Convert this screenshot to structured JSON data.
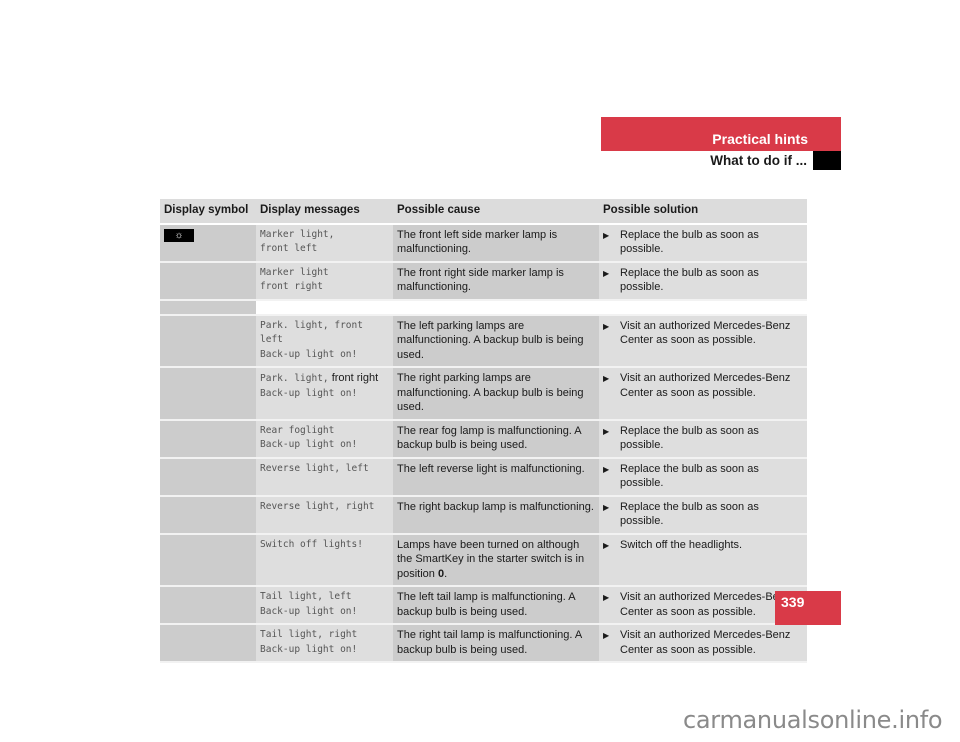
{
  "header": {
    "section_title": "Practical hints",
    "subsection_title": "What to do if ..."
  },
  "table": {
    "columns": [
      "Display symbol",
      "Display messages",
      "Possible cause",
      "Possible solution"
    ],
    "symbol": {
      "icon": "lamp-icon",
      "glyph": "☼"
    },
    "rows": [
      {
        "msg1": "Marker light,",
        "msg2": "front left",
        "cause": "The front left side marker lamp is malfunctioning.",
        "solution": "Replace the bulb as soon as possible."
      },
      {
        "msg1": "Marker light",
        "msg2": "front right",
        "cause": "The front right side marker lamp is malfunctioning.",
        "solution": "Replace the bulb as soon as possible."
      },
      {
        "msg1": "Park. light, front left",
        "msg2": "Back-up light on!",
        "cause": "The left parking lamps are malfunctioning. A backup bulb is being used.",
        "solution": "Visit an authorized Mercedes-Benz Center as soon as possible."
      },
      {
        "msg1": "Park. light,",
        "msg1_plain": " front right",
        "msg2": "Back-up light on!",
        "cause": "The right parking lamps are malfunctioning. A backup bulb is being used.",
        "solution": "Visit an authorized Mercedes-Benz Center as soon as possible."
      },
      {
        "msg1": "Rear foglight",
        "msg2": "Back-up light on!",
        "cause": "The rear fog lamp is malfunctioning. A backup bulb is being used.",
        "solution": "Replace the bulb as soon as possible."
      },
      {
        "msg1": "Reverse light, left",
        "msg2": "",
        "cause": "The left reverse light is malfunctioning.",
        "solution": "Replace the bulb as soon as possible."
      },
      {
        "msg1": "Reverse light, right",
        "msg2": "",
        "cause": "The right backup lamp is malfunctioning.",
        "solution": "Replace the bulb as soon as possible."
      },
      {
        "msg1": "Switch off lights!",
        "msg2": "",
        "cause": "Lamps have been turned on although the SmartKey in the starter switch is in position ",
        "cause_bold": "0",
        "cause_end": ".",
        "solution": "Switch off the headlights."
      },
      {
        "msg1": "Tail light, left",
        "msg2": "Back-up light on!",
        "cause": "The left tail lamp is malfunctioning. A backup bulb is being used.",
        "solution": "Visit an authorized Mercedes-Benz Center as soon as possible."
      },
      {
        "msg1": "Tail light, right",
        "msg2": "Back-up light on!",
        "cause": "The right tail lamp is malfunctioning. A backup bulb is being used.",
        "solution": "Visit an authorized Mercedes-Benz Center as soon as possible."
      }
    ],
    "bullet_glyph": "▶"
  },
  "footer": {
    "page_number": "339",
    "watermark": "carmanualsonline.info"
  }
}
